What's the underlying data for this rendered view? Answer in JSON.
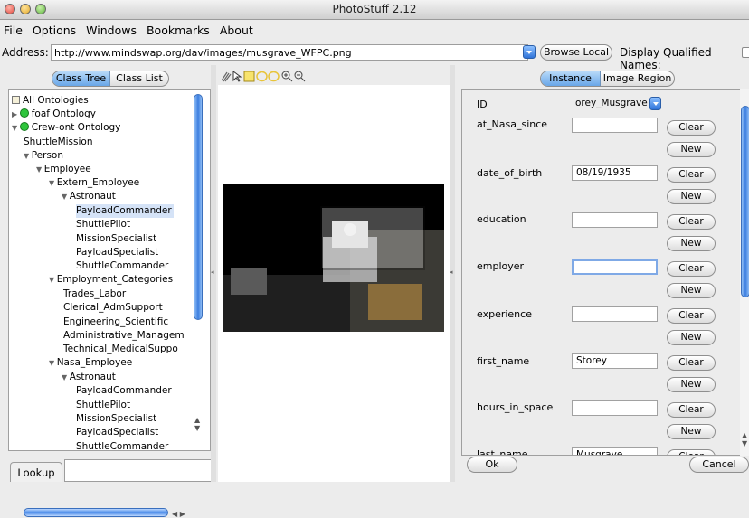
{
  "window": {
    "title": "PhotoStuff 2.12"
  },
  "menu": [
    "File",
    "Options",
    "Windows",
    "Bookmarks",
    "About"
  ],
  "address": {
    "label": "Address:",
    "value": "http://www.mindswap.org/dav/images/musgrave_WFPC.png",
    "browse_label": "Browse Local",
    "qualified_label": "Display Qualified Names:"
  },
  "left_tabs": {
    "class_tree": "Class Tree",
    "class_list": "Class List",
    "selected": "Class Tree"
  },
  "tree": [
    {
      "label": "All Ontologies",
      "icon": "tree-root-icon"
    },
    {
      "label": "foaf Ontology",
      "icon": "ontology-icon",
      "expanded": false
    },
    {
      "label": "Crew-ont Ontology",
      "icon": "ontology-icon",
      "expanded": true
    },
    {
      "label": "ShuttleMission"
    },
    {
      "label": "Person",
      "expanded": true
    },
    {
      "label": "Employee",
      "expanded": true
    },
    {
      "label": "Extern_Employee",
      "expanded": true
    },
    {
      "label": "Astronaut",
      "expanded": true
    },
    {
      "label": "PayloadCommander",
      "selected": true
    },
    {
      "label": "ShuttlePilot"
    },
    {
      "label": "MissionSpecialist"
    },
    {
      "label": "PayloadSpecialist"
    },
    {
      "label": "ShuttleCommander"
    },
    {
      "label": "Employment_Categories",
      "expanded": true
    },
    {
      "label": "Trades_Labor"
    },
    {
      "label": "Clerical_AdmSupport"
    },
    {
      "label": "Engineering_Scientific"
    },
    {
      "label": "Administrative_Managem"
    },
    {
      "label": "Technical_MedicalSuppo"
    },
    {
      "label": "Nasa_Employee",
      "expanded": true
    },
    {
      "label": "Astronaut",
      "expanded": true
    },
    {
      "label": "PayloadCommander"
    },
    {
      "label": "ShuttlePilot"
    },
    {
      "label": "MissionSpecialist"
    },
    {
      "label": "PayloadSpecialist"
    },
    {
      "label": "ShuttleCommander"
    }
  ],
  "lookup": {
    "label": "Lookup",
    "value": ""
  },
  "toolbar_icons": [
    "select-arrow-icon",
    "rectangle-tool-icon",
    "ellipse-tool-icon",
    "zoom-in-icon",
    "zoom-out-icon"
  ],
  "right_tabs": {
    "instance": "Instance",
    "image_region": "Image Region",
    "selected": "Instance"
  },
  "form": {
    "id_label": "ID",
    "id_value": "orey_Musgrave",
    "clear_label": "Clear",
    "new_label": "New",
    "fields": [
      {
        "label": "at_Nasa_since",
        "value": ""
      },
      {
        "label": "date_of_birth",
        "value": "08/19/1935"
      },
      {
        "label": "education",
        "value": ""
      },
      {
        "label": "employer",
        "value": "",
        "focused": true
      },
      {
        "label": "experience",
        "value": ""
      },
      {
        "label": "first_name",
        "value": "Storey"
      },
      {
        "label": "hours_in_space",
        "value": ""
      },
      {
        "label": "last_name",
        "value": "Musgrave"
      }
    ]
  },
  "buttons": {
    "ok": "Ok",
    "cancel": "Cancel"
  },
  "colors": {
    "accent": "#3c7ee0",
    "selection": "#d5e3f7",
    "ontology_green": "#2ec53c"
  }
}
